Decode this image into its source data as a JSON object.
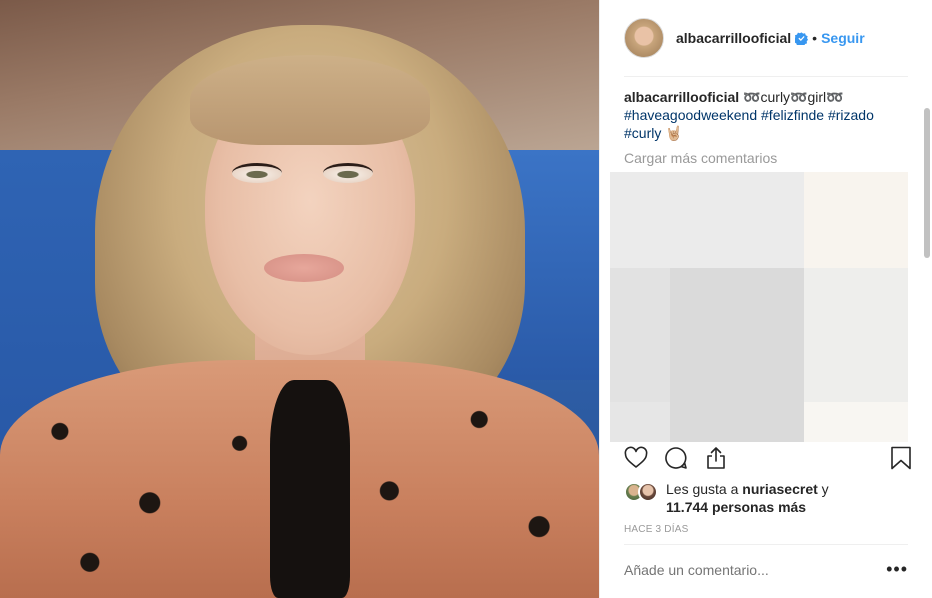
{
  "post": {
    "username": "albacarrillooficial",
    "separator": "•",
    "follow_label": "Seguir"
  },
  "caption": {
    "username": "albacarrillooficial",
    "line1": "➿curly➿girl➿",
    "hashtags": [
      "#haveagoodweekend",
      "#felizfinde",
      "#rizado",
      "#curly"
    ],
    "emoji": "🤘🏼"
  },
  "load_more": "Cargar más comentarios",
  "likes": {
    "prefix": "Les gusta a",
    "user": "nuriasecret",
    "connector": "y",
    "count_text": "11.744 personas más"
  },
  "time_ago": "HACE 3 DÍAS",
  "comment_input": {
    "placeholder": "Añade un comentario..."
  },
  "more_options": "•••",
  "icons": {
    "verified": "verified-badge-icon",
    "like": "heart-icon",
    "comment": "comment-bubble-icon",
    "share": "share-icon",
    "save": "bookmark-icon"
  },
  "colors": {
    "accent": "#3897f0",
    "hashtag": "#003569",
    "muted": "#999999",
    "text": "#262626"
  },
  "ad_grid_colors": [
    "#ebebeb",
    "#ebebeb",
    "#f8f4ee",
    "#e2e2e2",
    "#dadada",
    "#eeeeec",
    "#e6e6e6",
    "#dadada",
    "#f8f6f2"
  ]
}
